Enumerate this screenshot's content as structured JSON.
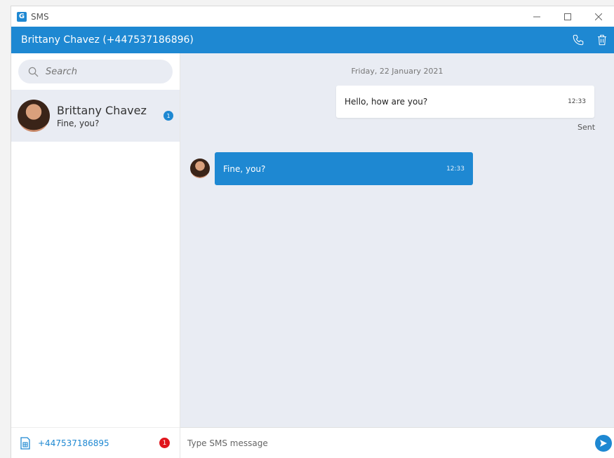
{
  "window": {
    "title": "SMS",
    "logo_letter": "G"
  },
  "header": {
    "contact_title": "Brittany Chavez (+447537186896)"
  },
  "search": {
    "placeholder": "Search"
  },
  "conversations": [
    {
      "name": "Brittany Chavez",
      "preview": "Fine, you?",
      "unread": "1"
    }
  ],
  "footer": {
    "phone_number": "+447537186895",
    "badge": "1"
  },
  "chat": {
    "date": "Friday, 22 January 2021",
    "messages": [
      {
        "direction": "out",
        "text": "Hello, how are you?",
        "time": "12:33",
        "status": "Sent"
      },
      {
        "direction": "in",
        "text": "Fine, you?",
        "time": "12:33"
      }
    ]
  },
  "composer": {
    "placeholder": "Type SMS message"
  },
  "colors": {
    "accent": "#1e88d2",
    "chat_bg": "#e9ecf3",
    "alert": "#e0151c"
  },
  "icons": {
    "app": "g-logo-icon",
    "minimize": "minimize-icon",
    "maximize": "maximize-icon",
    "close": "close-icon",
    "call": "phone-icon",
    "delete": "trash-icon",
    "search": "search-icon",
    "sim": "sim-card-icon",
    "send": "send-icon"
  }
}
